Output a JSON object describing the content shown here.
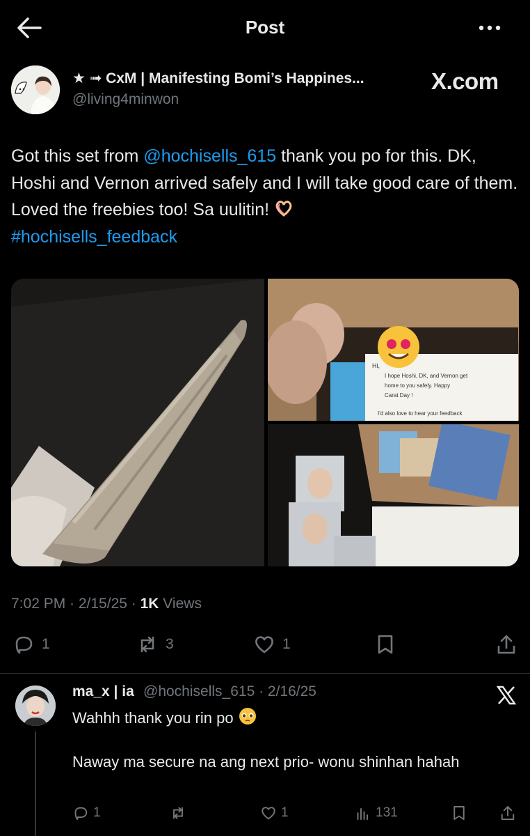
{
  "header": {
    "title": "Post"
  },
  "post": {
    "display_name": "★ ➟ CxM | Manifesting Bomi’s Happines...",
    "handle": "@living4minwon",
    "watermark": "X.com",
    "text_part1": "Got this set from ",
    "mention": "@hochisells_615",
    "text_part2": " thank you po for this. DK, Hoshi and Vernon arrived safely and I will take good care of them. Loved the freebies too! Sa uulitin! ",
    "hashtag": "#hochisells_feedback",
    "time": "7:02 PM · 2/15/25 · ",
    "views_count": "1K",
    "views_label": " Views",
    "replies": "1",
    "reposts": "3",
    "likes": "1"
  },
  "media": {
    "note_line1": "Hi,",
    "note_line2": "I hope Hoshi, DK, and Vernon get",
    "note_line3": "home to you safely. Happy",
    "note_line4": "Carat Day !",
    "note_line5": "I'd also love to hear your feedback"
  },
  "reply": {
    "name": "ma_x | ia",
    "handle_time": "@hochisells_615 · 2/16/25",
    "text1": "Wahhh thank you rin po ",
    "text2": "Naway ma secure na ang next prio- wonu shinhan hahah",
    "replies": "1",
    "likes": "1",
    "views": "131"
  },
  "colors": {
    "link": "#1d9bf0",
    "muted": "#71767b",
    "text": "#e7e9ea",
    "bg": "#000000"
  }
}
